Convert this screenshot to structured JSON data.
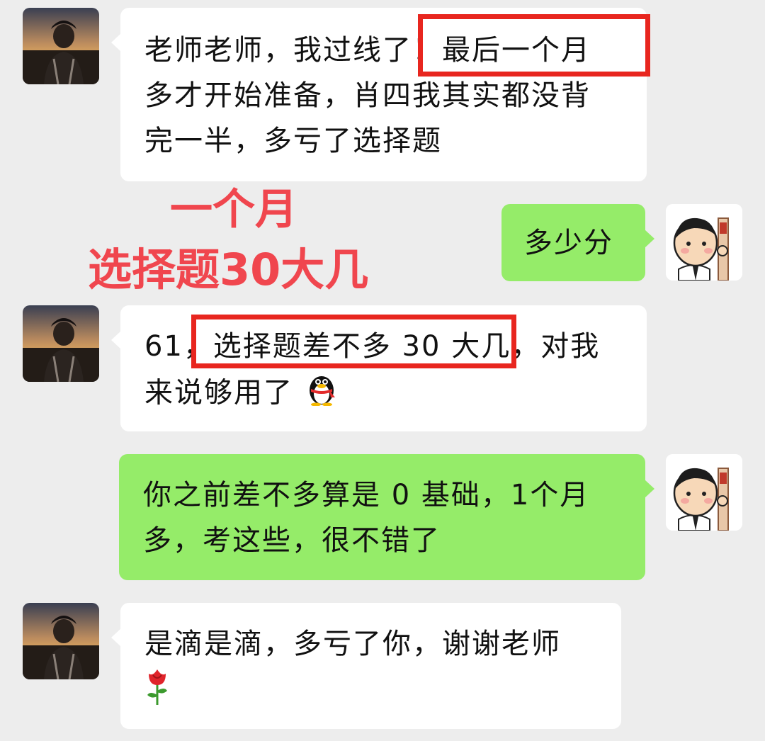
{
  "messages": [
    {
      "from": "student",
      "lines": [
        "老师老师，我过线了！最后一个月",
        "多才开始准备，肖四我其实都没背",
        "完一半，多亏了选择题"
      ]
    },
    {
      "from": "teacher",
      "lines": [
        "多少分"
      ]
    },
    {
      "from": "student",
      "lines": [
        "61，选择题差不多 30 大几，对我",
        "来说够用了"
      ],
      "emoji": "penguin-emoji"
    },
    {
      "from": "teacher",
      "lines": [
        "你之前差不多算是 0 基础，1个月",
        "多，考这些，很不错了"
      ]
    },
    {
      "from": "student",
      "lines": [
        "是滴是滴，多亏了你，谢谢老师"
      ],
      "emoji": "rose-emoji"
    }
  ],
  "annotations": {
    "note_line_1": "一个月",
    "note_line_2": "选择题30大几",
    "color": "#f0464e",
    "box_color": "#e8261f"
  },
  "colors": {
    "background": "#ededed",
    "incoming_bubble": "#ffffff",
    "outgoing_bubble": "#95ec69"
  }
}
